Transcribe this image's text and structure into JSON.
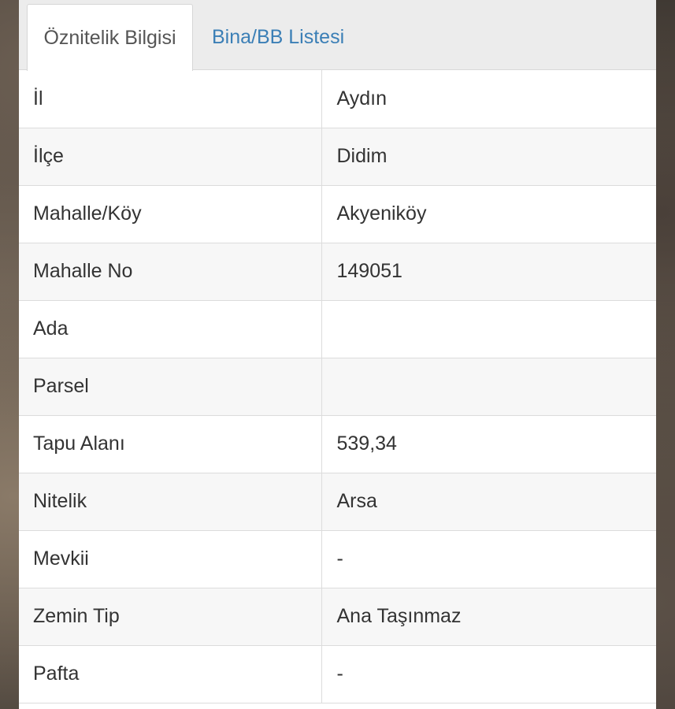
{
  "tabs": [
    {
      "label": "Öznitelik Bilgisi",
      "active": true
    },
    {
      "label": "Bina/BB Listesi",
      "active": false
    }
  ],
  "rows": [
    {
      "label": "İl",
      "value": "Aydın"
    },
    {
      "label": "İlçe",
      "value": "Didim"
    },
    {
      "label": "Mahalle/Köy",
      "value": "Akyeniköy"
    },
    {
      "label": "Mahalle No",
      "value": "149051"
    },
    {
      "label": "Ada",
      "value": ""
    },
    {
      "label": "Parsel",
      "value": ""
    },
    {
      "label": "Tapu Alanı",
      "value": "539,34"
    },
    {
      "label": "Nitelik",
      "value": "Arsa"
    },
    {
      "label": "Mevkii",
      "value": "-"
    },
    {
      "label": "Zemin Tip",
      "value": "Ana Taşınmaz"
    },
    {
      "label": "Pafta",
      "value": "-"
    }
  ],
  "colors": {
    "tab_link": "#3b7fb6",
    "text": "#333333",
    "row_alt": "#f7f7f7"
  }
}
